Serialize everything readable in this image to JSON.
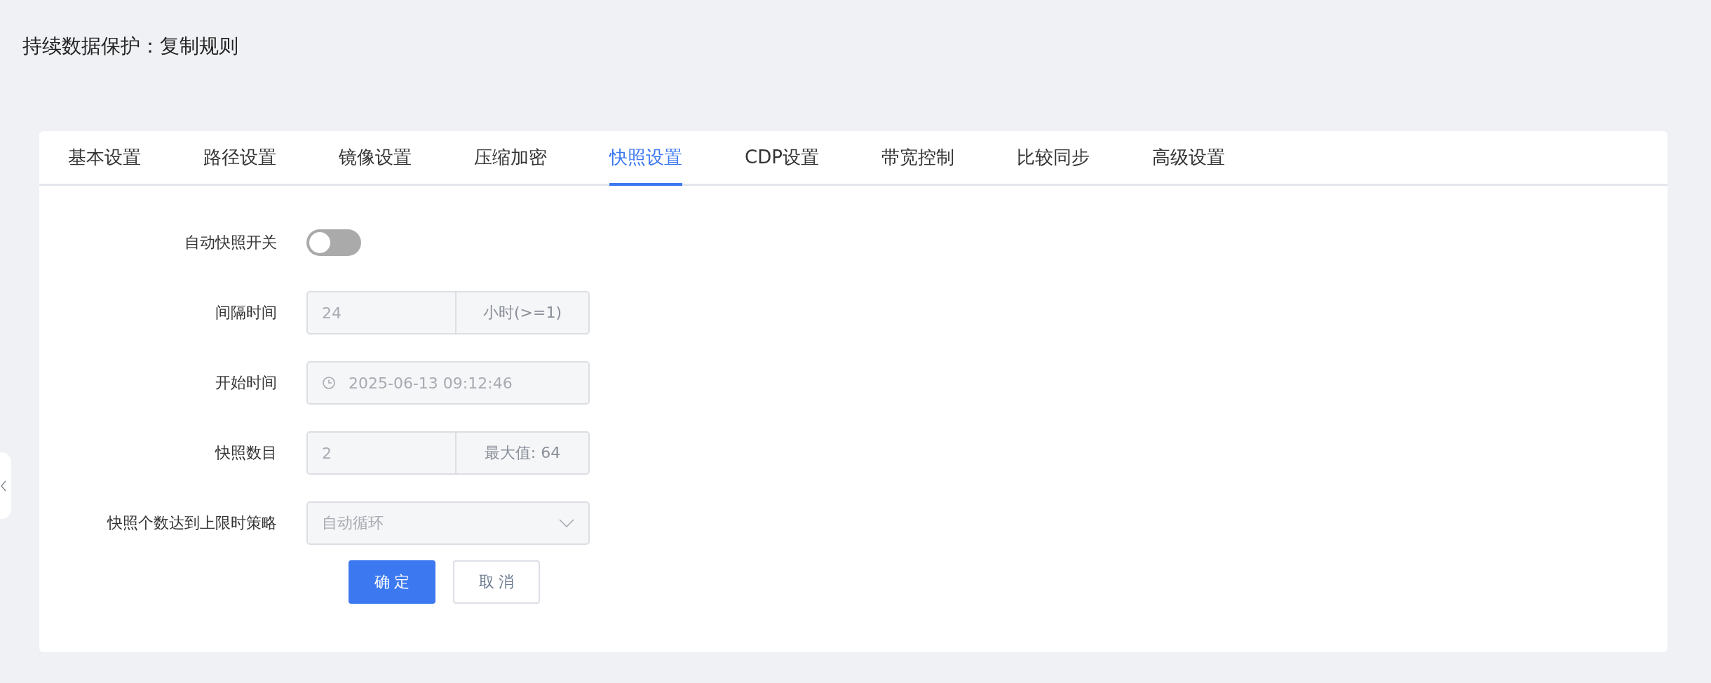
{
  "page_title": "持续数据保护：复制规则",
  "tabs": [
    {
      "label": "基本设置",
      "selected": false
    },
    {
      "label": "路径设置",
      "selected": false
    },
    {
      "label": "镜像设置",
      "selected": false
    },
    {
      "label": "压缩加密",
      "selected": false
    },
    {
      "label": "快照设置",
      "selected": true
    },
    {
      "label": "CDP设置",
      "selected": false
    },
    {
      "label": "带宽控制",
      "selected": false
    },
    {
      "label": "比较同步",
      "selected": false
    },
    {
      "label": "高级设置",
      "selected": false
    }
  ],
  "form": [
    {
      "kind": "toggle",
      "label": "自动快照开关",
      "on": false
    },
    {
      "kind": "input_append",
      "label": "间隔时间",
      "value": "24",
      "append": "小时(>=1)",
      "disabled": true
    },
    {
      "kind": "datetime",
      "label": "开始时间",
      "value": "2025-06-13 09:12:46",
      "disabled": true
    },
    {
      "kind": "input_append",
      "label": "快照数目",
      "value": "2",
      "append": "最大值: 64",
      "disabled": true
    },
    {
      "kind": "select",
      "label": "快照个数达到上限时策略",
      "value": "自动循环",
      "disabled": true
    }
  ],
  "buttons": [
    {
      "label": "确 定",
      "kind": "primary"
    },
    {
      "label": "取 消",
      "kind": "default"
    }
  ]
}
